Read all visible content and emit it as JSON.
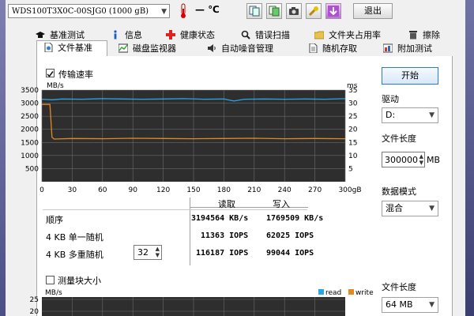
{
  "toolbar": {
    "drive": "WDS100T3X0C-00SJG0 (1000 gB)",
    "temp_value": "—",
    "temp_unit": "℃",
    "exit_label": "退出"
  },
  "tabs_row1": [
    "基准测试",
    "信息",
    "健康状态",
    "错误扫描",
    "文件夹占用率",
    "擦除"
  ],
  "tabs_row2": [
    "文件基准",
    "磁盘监视器",
    "自动噪音管理",
    "随机存取",
    "附加测试"
  ],
  "active_tab": "文件基准",
  "transfer_checkbox_label": "传输速率",
  "sidebar": {
    "start_label": "开始",
    "drive_label": "驱动",
    "drive_value": "D:",
    "file_length_label": "文件长度",
    "file_length_value": "300000",
    "file_length_unit": "MB",
    "data_mode_label": "数据模式",
    "data_mode_value": "混合",
    "block_length_label": "文件长度",
    "block_length_value": "64 MB"
  },
  "results": {
    "read_header": "读取",
    "write_header": "写入",
    "rows": [
      {
        "label": "顺序",
        "read": "3194564 KB/s",
        "write": "1769509 KB/s"
      },
      {
        "label": "4 KB 单一随机",
        "read": "11363 IOPS",
        "write": "62025 IOPS"
      },
      {
        "label": "4 KB 多重随机",
        "read": "116187 IOPS",
        "write": "99044 IOPS"
      }
    ],
    "queue_depth": "32"
  },
  "block_checkbox_label": "测量块大小",
  "chart_data": [
    {
      "type": "line",
      "y_left_label": "MB/s",
      "y_right_label": "ms",
      "x_unit_label": "gB",
      "x_ticks": [
        "0",
        "30",
        "60",
        "90",
        "120",
        "150",
        "180",
        "210",
        "240",
        "270",
        "300"
      ],
      "y_left_ticks": [
        "3500",
        "3000",
        "2500",
        "2000",
        "1500",
        "1000",
        "500"
      ],
      "y_right_ticks": [
        "35",
        "30",
        "25",
        "20",
        "15",
        "10",
        "5"
      ],
      "xlim": [
        0,
        300
      ],
      "ylim": [
        0,
        3500
      ],
      "grid": true,
      "series": [
        {
          "name": "read",
          "color": "#2aa6e8",
          "x": [
            0,
            10,
            20,
            40,
            60,
            80,
            100,
            120,
            140,
            160,
            180,
            190,
            200,
            220,
            240,
            260,
            280,
            300
          ],
          "y": [
            3150,
            3130,
            3160,
            3150,
            3170,
            3160,
            3150,
            3160,
            3170,
            3150,
            3160,
            3080,
            3150,
            3160,
            3150,
            3160,
            3150,
            3170
          ]
        },
        {
          "name": "write",
          "color": "#e08a20",
          "x": [
            0,
            8,
            10,
            12,
            30,
            60,
            90,
            120,
            150,
            180,
            210,
            240,
            270,
            300
          ],
          "y": [
            2950,
            2950,
            1700,
            1630,
            1650,
            1640,
            1660,
            1650,
            1640,
            1650,
            1660,
            1640,
            1650,
            1640
          ]
        }
      ]
    },
    {
      "type": "line",
      "y_left_label": "MB/s",
      "legend": [
        "read",
        "write"
      ],
      "legend_colors": [
        "#2aa6e8",
        "#e08a20"
      ],
      "y_left_ticks": [
        "25",
        "20"
      ],
      "series": []
    }
  ]
}
